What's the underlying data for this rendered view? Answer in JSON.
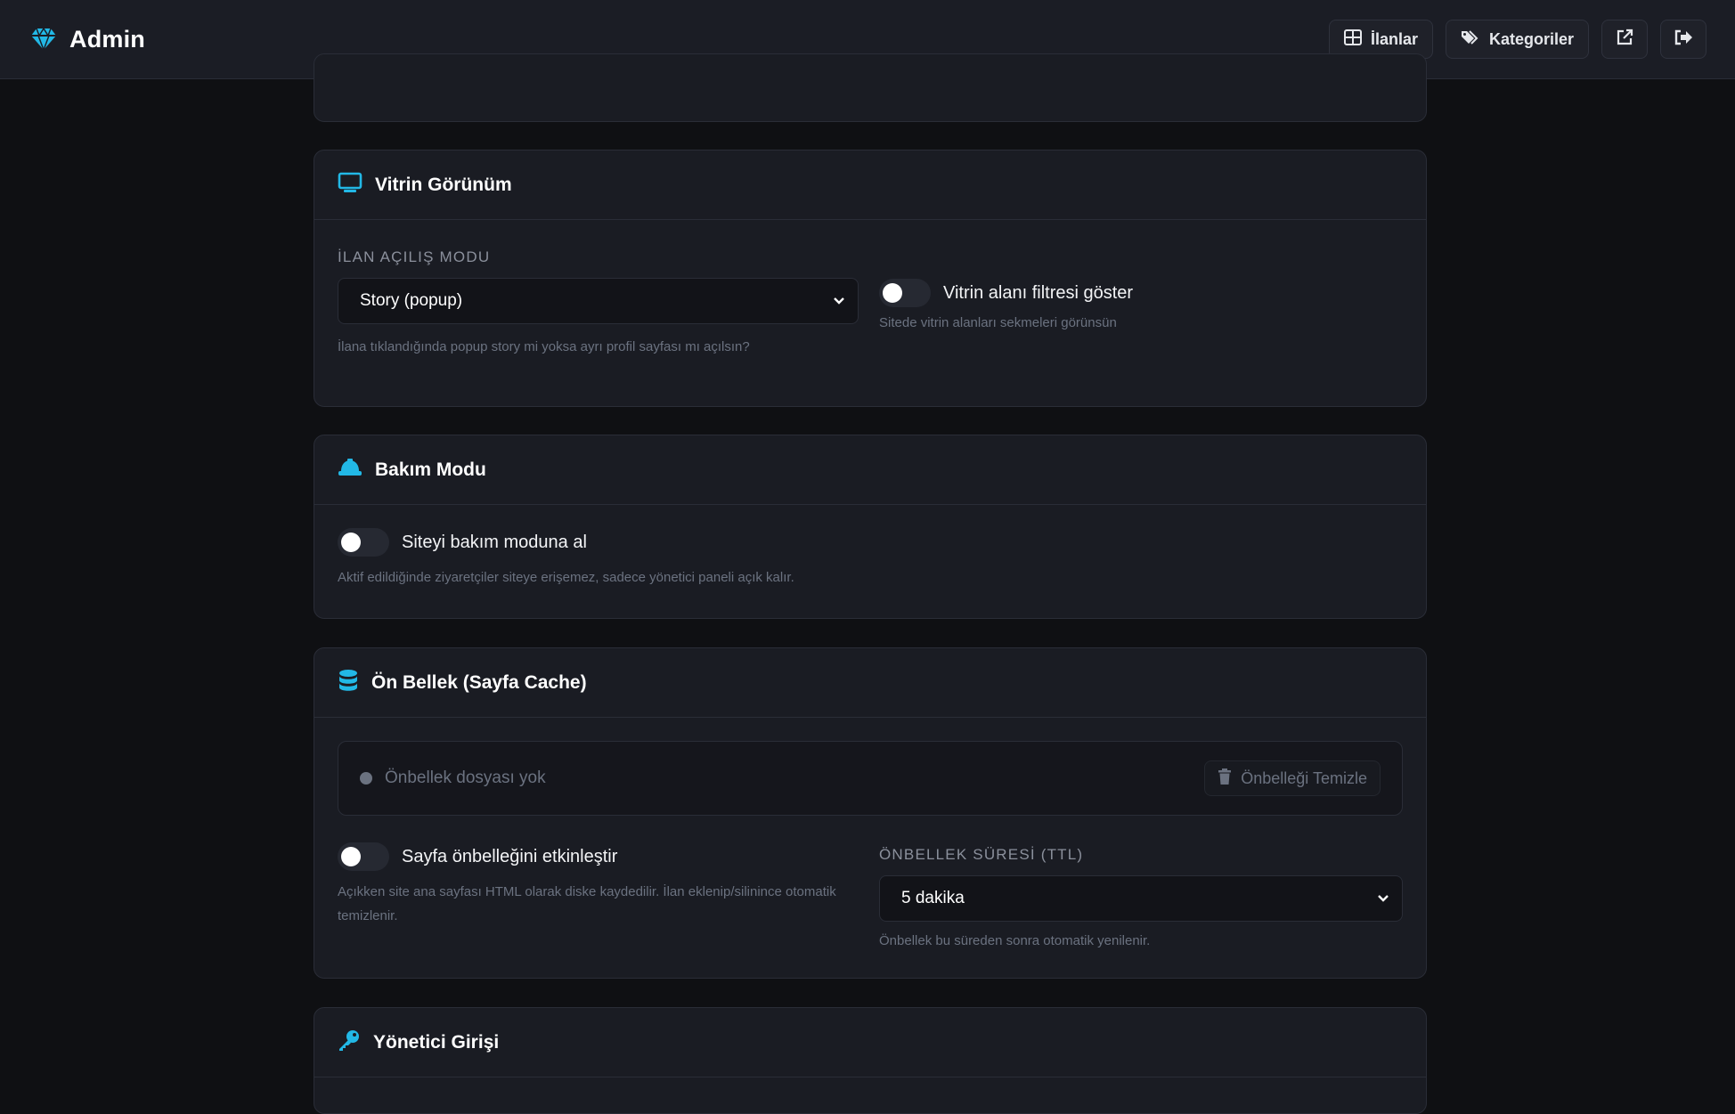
{
  "header": {
    "brand_title": "Admin",
    "nav": {
      "listings_label": "İlanlar",
      "categories_label": "Kategoriler"
    }
  },
  "colors": {
    "accent": "#22b8e6",
    "background": "#0f1013",
    "card": "#1a1c23"
  },
  "icons": {
    "brand": "gem-icon",
    "listings": "grid-icon",
    "categories": "tags-icon",
    "external": "external-link-icon",
    "logout": "sign-out-icon",
    "display": "monitor-icon",
    "maintenance": "hard-hat-icon",
    "cache": "database-icon",
    "login": "key-icon",
    "trash": "trash-icon"
  },
  "sections": {
    "display": {
      "title": "Vitrin Görünüm",
      "open_mode_label": "İLAN AÇILIŞ MODU",
      "open_mode_value": "Story (popup)",
      "open_mode_help": "İlana tıklandığında popup story mi yoksa ayrı profil sayfası mı açılsın?",
      "filter_toggle_label": "Vitrin alanı filtresi göster",
      "filter_toggle_on": false,
      "filter_toggle_help": "Sitede vitrin alanları sekmeleri görünsün"
    },
    "maintenance": {
      "title": "Bakım Modu",
      "toggle_label": "Siteyi bakım moduna al",
      "toggle_on": false,
      "help": "Aktif edildiğinde ziyaretçiler siteye erişemez, sadece yönetici paneli açık kalır."
    },
    "cache": {
      "title": "Ön Bellek (Sayfa Cache)",
      "status_text": "Önbellek dosyası yok",
      "clear_button": "Önbelleği Temizle",
      "enable_label": "Sayfa önbelleğini etkinleştir",
      "enable_on": false,
      "enable_help": "Açıkken site ana sayfası HTML olarak diske kaydedilir. İlan eklenip/silinince otomatik temizlenir.",
      "ttl_label": "ÖNBELLEK SÜRESİ (TTL)",
      "ttl_value": "5 dakika",
      "ttl_help": "Önbellek bu süreden sonra otomatik yenilenir."
    },
    "admin_login": {
      "title": "Yönetici Girişi"
    }
  }
}
